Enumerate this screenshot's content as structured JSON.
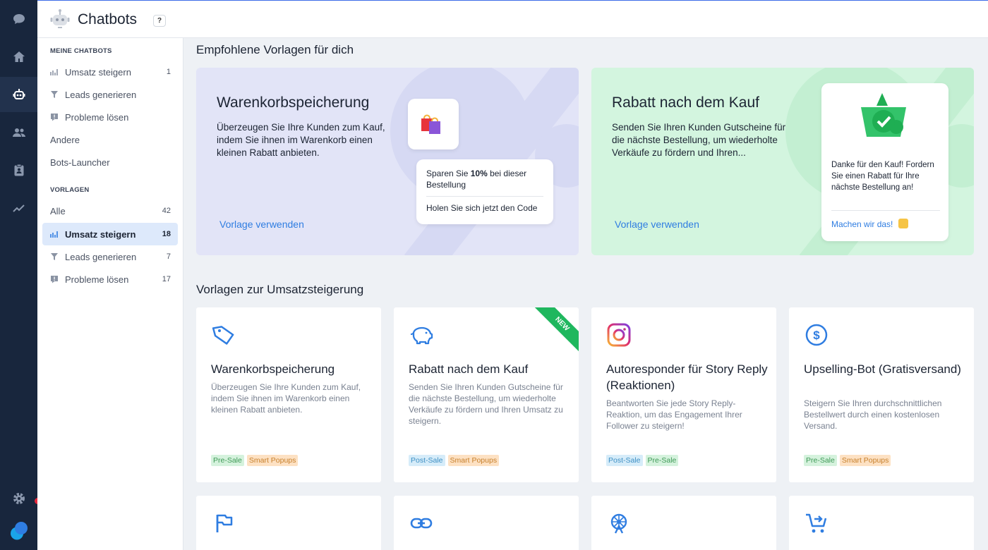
{
  "header": {
    "title": "Chatbots",
    "help_label": "?"
  },
  "sidebar": {
    "section_my": "MEINE CHATBOTS",
    "my_items": [
      {
        "label": "Umsatz steigern",
        "count": "1"
      },
      {
        "label": "Leads generieren",
        "count": ""
      },
      {
        "label": "Probleme lösen",
        "count": ""
      }
    ],
    "other": "Andere",
    "launcher": "Bots-Launcher",
    "section_templates": "VORLAGEN",
    "templates": [
      {
        "label": "Alle",
        "count": "42"
      },
      {
        "label": "Umsatz steigern",
        "count": "18"
      },
      {
        "label": "Leads generieren",
        "count": "7"
      },
      {
        "label": "Probleme lösen",
        "count": "17"
      }
    ]
  },
  "main": {
    "recommended_title": "Empfohlene Vorlagen für dich",
    "hero1": {
      "title": "Warenkorbspeicherung",
      "desc": "Überzeugen Sie Ihre Kunden zum Kauf, indem Sie ihnen im Warenkorb einen kleinen Rabatt anbieten.",
      "link": "Vorlage verwenden",
      "bubble_line1_pre": "Sparen Sie ",
      "bubble_line1_bold": "10%",
      "bubble_line1_post": " bei dieser Bestellung",
      "bubble_line2": "Holen Sie sich jetzt den Code"
    },
    "hero2": {
      "title": "Rabatt nach dem Kauf",
      "desc": "Senden Sie Ihren Kunden Gutscheine für die nächste Bestellung, um wiederholte Verkäufe zu fördern und Ihren...",
      "link": "Vorlage verwenden",
      "bubble_text": "Danke für den Kauf! Fordern Sie einen Rabatt für Ihre nächste Bestellung an!",
      "bubble_link": "Machen wir das!"
    },
    "sales_title": "Vorlagen zur Umsatzsteigerung",
    "cards": [
      {
        "title": "Warenkorbspeicherung",
        "desc": "Überzeugen Sie Ihre Kunden zum Kauf, indem Sie ihnen im Warenkorb einen kleinen Rabatt anbieten.",
        "tags": [
          "Pre-Sale",
          "Smart Popups"
        ]
      },
      {
        "title": "Rabatt nach dem Kauf",
        "desc": "Senden Sie Ihren Kunden Gutscheine für die nächste Bestellung, um wiederholte Verkäufe zu fördern und Ihren Umsatz zu steigern.",
        "tags": [
          "Post-Sale",
          "Smart Popups"
        ],
        "ribbon": "NEW"
      },
      {
        "title": "Autoresponder für Story Reply (Reaktionen)",
        "desc": "Beantworten Sie jede Story Reply-Reaktion, um das Engagement Ihrer Follower zu steigern!",
        "tags": [
          "Post-Sale",
          "Pre-Sale"
        ]
      },
      {
        "title": "Upselling-Bot (Gratisversand)",
        "desc": "Steigern Sie Ihren durchschnittlichen Bestellwert durch einen kostenlosen Versand.",
        "tags": [
          "Pre-Sale",
          "Smart Popups"
        ]
      }
    ]
  },
  "colors": {
    "accent": "#2f7de1",
    "rail": "#18263d",
    "notification": "#e8283c"
  }
}
